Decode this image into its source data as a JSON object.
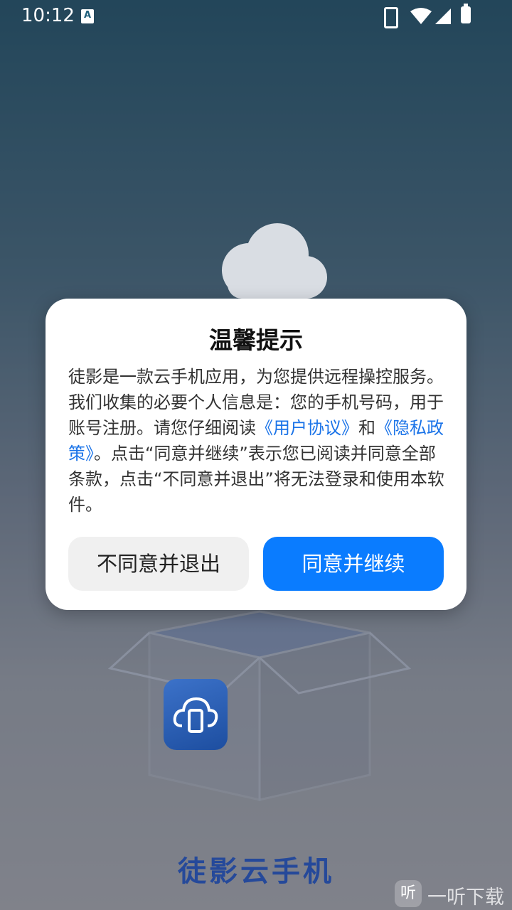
{
  "status_bar": {
    "time": "10:12",
    "notification_icon_letter": "A",
    "icons": [
      "phone-icon",
      "wifi-icon",
      "signal-icon",
      "battery-icon"
    ]
  },
  "background": {
    "brand_text": "徒影云手机",
    "brand_color": "#25499a",
    "watermark_text": "一听下载",
    "watermark_logo_text": "听"
  },
  "dialog": {
    "title": "温馨提示",
    "body_part1": "徒影是一款云手机应用，为您提供远程操控服务。我们收集的必要个人信息是：您的手机号码，用于账号注册。请您仔细阅读",
    "user_agreement_link": "《用户协议》",
    "body_and": "和",
    "privacy_policy_link": "《隐私政策》",
    "body_part2": "。点击“同意并继续”表示您已阅读并同意全部条款，点击“不同意并退出”将无法登录和使用本软件。",
    "cancel_label": "不同意并退出",
    "confirm_label": "同意并继续",
    "link_color": "#1a73e8",
    "confirm_color": "#0a7cff"
  }
}
